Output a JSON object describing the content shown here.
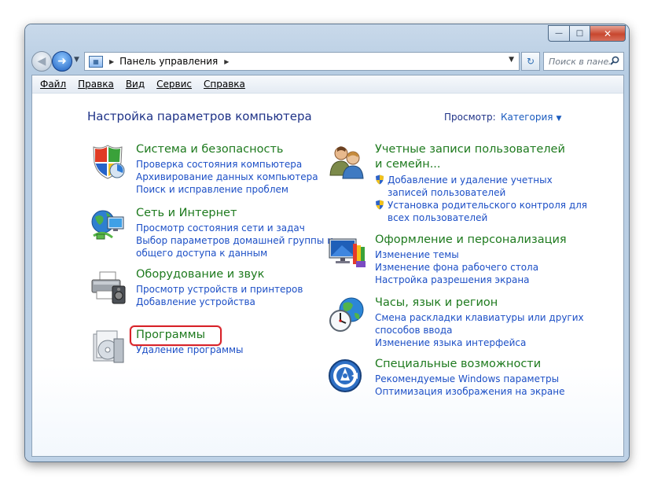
{
  "window": {
    "buttons": {
      "minimize": "—",
      "maximize": "□",
      "close": "✕"
    }
  },
  "nav": {
    "back_glyph": "◀",
    "forward_glyph": "➜",
    "history_glyph": "▼",
    "breadcrumb": [
      "Панель управления"
    ],
    "crumb_sep": "▶",
    "address_dropdown": "▼",
    "refresh_glyph": "↻",
    "search_placeholder": "Поиск в панели управления",
    "search_icon": "search-icon"
  },
  "menu": [
    "Файл",
    "Правка",
    "Вид",
    "Сервис",
    "Справка"
  ],
  "page": {
    "title": "Настройка параметров компьютера",
    "view_label": "Просмотр:",
    "view_value": "Категория",
    "view_arrow": "▼"
  },
  "categories_left": [
    {
      "title": "Система и безопасность",
      "icon": "shield-icon",
      "links": [
        "Проверка состояния компьютера",
        "Архивирование данных компьютера",
        "Поиск и исправление проблем"
      ]
    },
    {
      "title": "Сеть и Интернет",
      "icon": "network-icon",
      "links": [
        "Просмотр состояния сети и задач",
        "Выбор параметров домашней группы и",
        "общего доступа к данным"
      ]
    },
    {
      "title": "Оборудование и звук",
      "icon": "printer-icon",
      "links": [
        "Просмотр устройств и принтеров",
        "Добавление устройства"
      ]
    },
    {
      "title": "Программы",
      "icon": "programs-icon",
      "links": [
        "Удаление программы"
      ]
    }
  ],
  "categories_right": [
    {
      "title_lines": [
        "Учетные записи пользователей",
        "и семейн..."
      ],
      "icon": "users-icon",
      "links": [
        {
          "lines": [
            "Добавление и удаление учетных",
            "записей пользователей"
          ],
          "shield": true
        },
        {
          "lines": [
            "Установка родительского контроля для",
            "всех пользователей"
          ],
          "shield": true
        }
      ]
    },
    {
      "title_lines": [
        "Оформление и персонализация"
      ],
      "icon": "appearance-icon",
      "links": [
        {
          "lines": [
            "Изменение темы"
          ]
        },
        {
          "lines": [
            "Изменение фона рабочего стола"
          ]
        },
        {
          "lines": [
            "Настройка разрешения экрана"
          ]
        }
      ]
    },
    {
      "title_lines": [
        "Часы, язык и регион"
      ],
      "icon": "clock-globe-icon",
      "links": [
        {
          "lines": [
            "Смена раскладки клавиатуры или других",
            "способов ввода"
          ]
        },
        {
          "lines": [
            "Изменение языка интерфейса"
          ]
        }
      ]
    },
    {
      "title_lines": [
        "Специальные возможности"
      ],
      "icon": "accessibility-icon",
      "links": [
        {
          "lines": [
            "Рекомендуемые Windows параметры"
          ]
        },
        {
          "lines": [
            "Оптимизация изображения на экране"
          ]
        }
      ]
    }
  ],
  "colors": {
    "heading_green": "#1e7a1e",
    "link_blue": "#1c4fc6",
    "title_navy": "#1e3287",
    "highlight_red": "#d8232a"
  }
}
